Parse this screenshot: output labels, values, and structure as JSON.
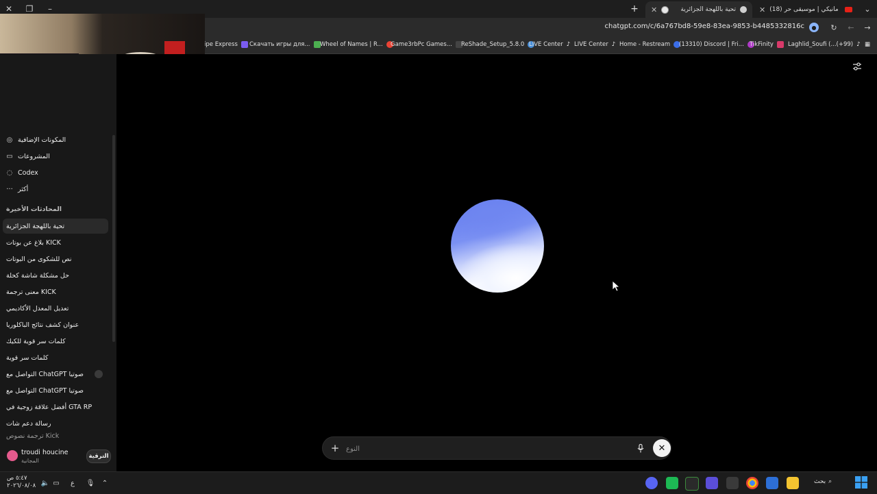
{
  "browser": {
    "tabs": [
      {
        "title": "تحية باللهجة الجزائرية",
        "active": true
      },
      {
        "title": "(18) انحداك مانيكي | موسيقى حر",
        "active": false
      }
    ],
    "url": "chatgpt.com/c/6a767bd8-59e8-83ea-9853-b4485332816c",
    "bookmarks": [
      "ipe Express",
      "Скачать игры для...",
      "Wheel of Names | R...",
      "Game3rbPc Games...",
      "ReShade_Setup_5.8.0",
      "LIVE Center",
      "LIVE Center",
      "Home - Restream",
      "(13310) Discord | Fri...",
      "TikFinity",
      "Laghlid_Soufi (...(+99)"
    ]
  },
  "sidebar": {
    "nav": [
      {
        "label": "المكونات الإضافية",
        "icon": "apps-icon"
      },
      {
        "label": "المشروعات",
        "icon": "folder-icon"
      },
      {
        "label": "Codex",
        "icon": "codex-icon"
      },
      {
        "label": "أكثر",
        "icon": "more-icon"
      }
    ],
    "recent_heading": "المحادثات الأخيرة",
    "chats": [
      "تحية باللهجة الجزائرية",
      "بلاغ عن بوتات KICK",
      "نص للشكوى من البوتات",
      "حل مشكلة شاشة كحلة",
      "معنى ترجمة KICK",
      "تعديل المعدل الأكاديمي",
      "عنوان كشف نتائج الباكلوريا",
      "كلمات سر قوية للكيك",
      "كلمات سر قوية",
      "التواصل مع ChatGPT صوتيا",
      "التواصل مع ChatGPT صوتيا",
      "أفضل علاقة زوجية في GTA RP",
      "رسالة دعم شات",
      "ترجمة نصوص Kick"
    ],
    "user": {
      "name": "troudi houcine",
      "plan": "المجانية",
      "upgrade_label": "الترقية"
    }
  },
  "composer": {
    "placeholder": "النوع"
  },
  "taskbar": {
    "time": "٥:٤٧ ص",
    "date": "٢٠٢٦/٠٨/٠٨",
    "lang": "ع",
    "search_label": "بحث"
  },
  "colors": {
    "accent_orb": "#6f86f0",
    "avatar": "#e45a8c",
    "background": "#000000"
  }
}
